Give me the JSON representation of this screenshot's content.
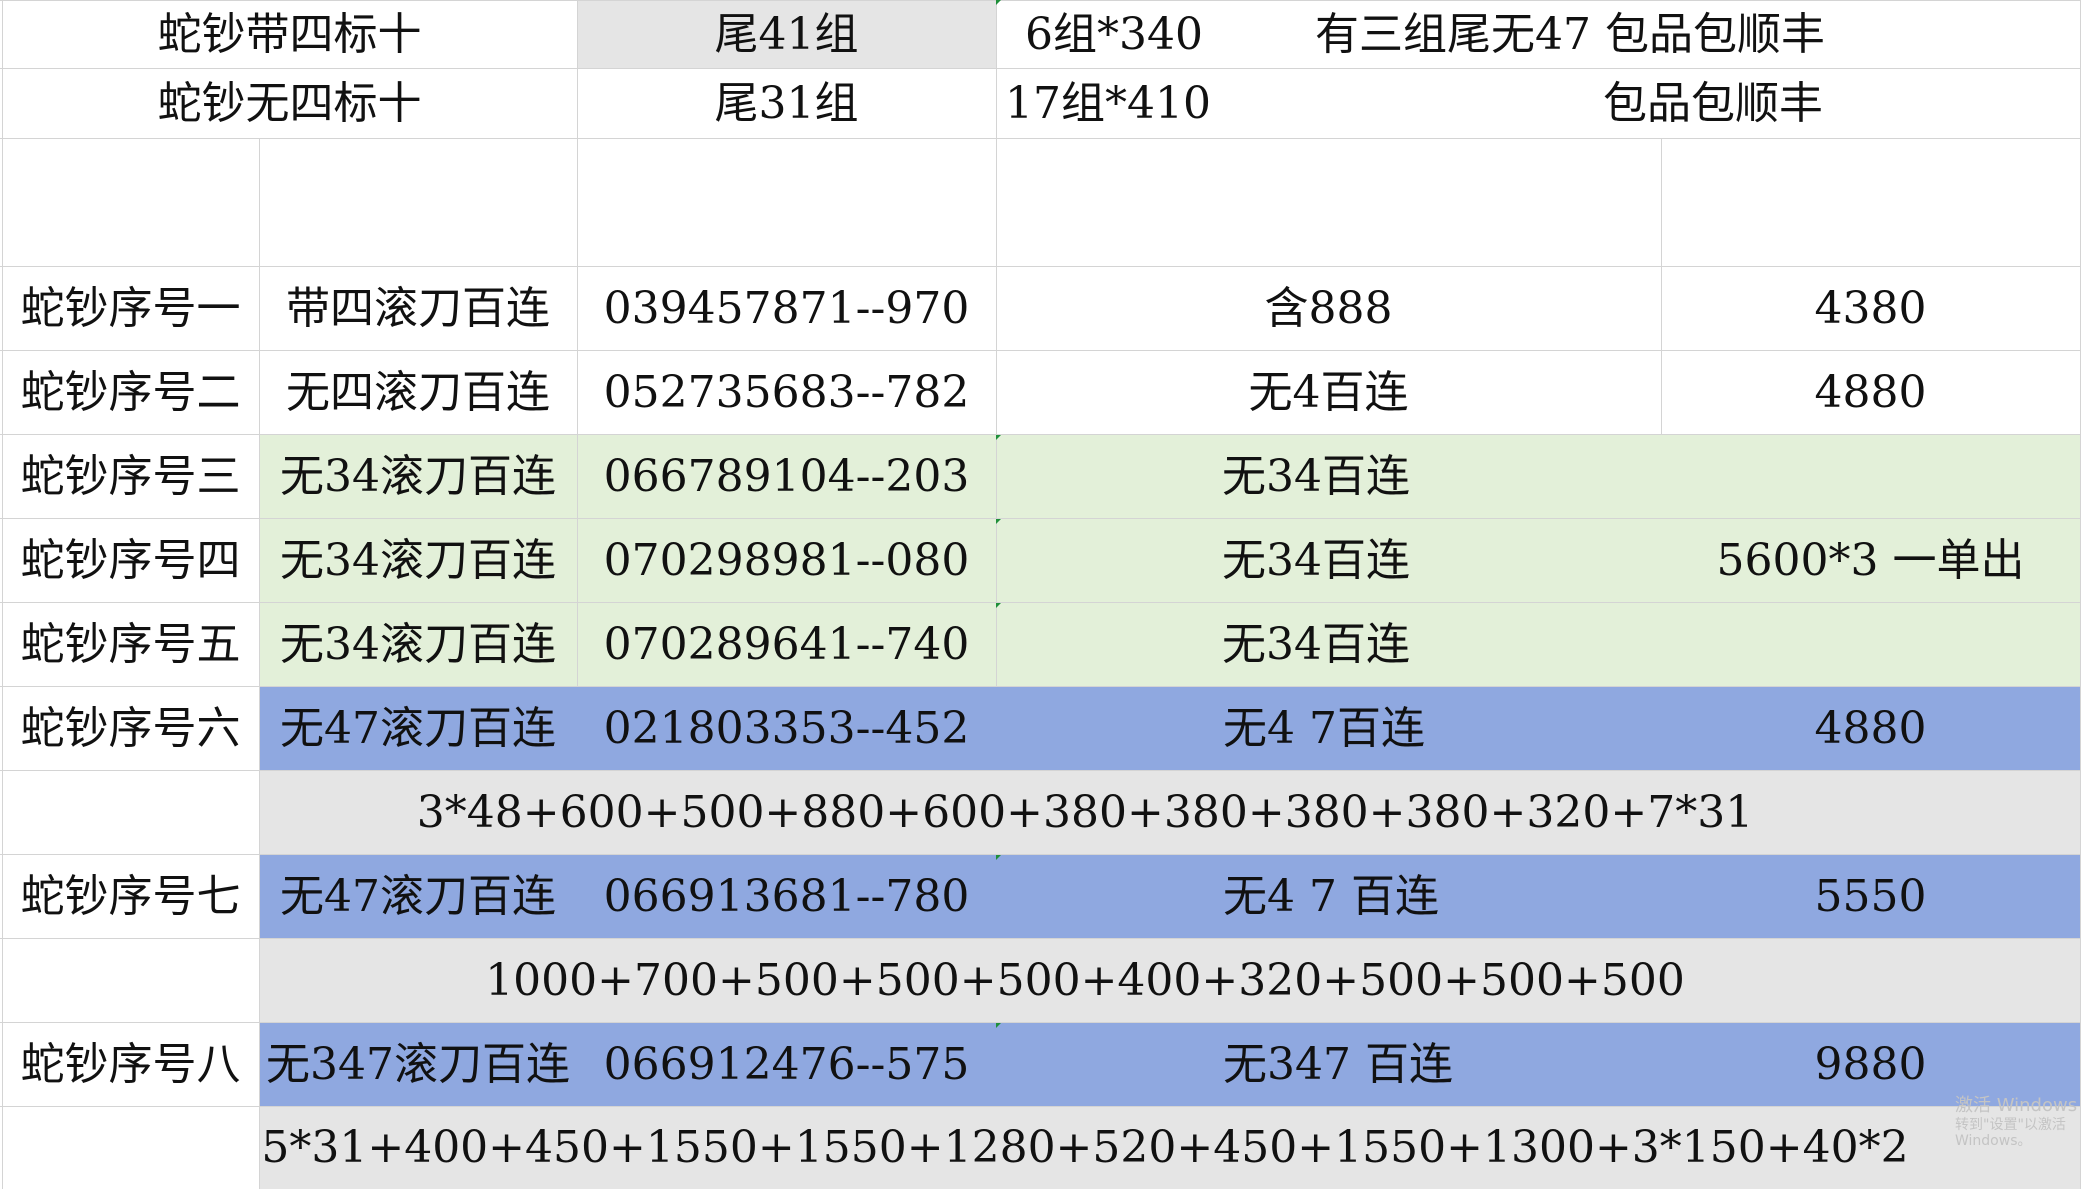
{
  "colors": {
    "green_fill": "#e3f0d9",
    "blue_fill": "#8fa8e0",
    "grey_fill": "#e5e5e5",
    "selected_fill": "#e5e5e5"
  },
  "header_rows": [
    {
      "name": "蛇钞带四标十",
      "tail": "尾41组",
      "groups": "6组*340",
      "note": "有三组尾无47  包品包顺丰"
    },
    {
      "name": "蛇钞无四标十",
      "tail": "尾31组",
      "groups": "17组*410",
      "note": "包品包顺丰"
    }
  ],
  "rows": [
    {
      "label": "蛇钞序号一",
      "desc": "带四滚刀百连",
      "serial": "039457871--970",
      "feature": "含888",
      "price": "4380"
    },
    {
      "label": "蛇钞序号二",
      "desc": "无四滚刀百连",
      "serial": "052735683--782",
      "feature": "无4百连",
      "price": "4880"
    },
    {
      "label": "蛇钞序号三",
      "desc": "无34滚刀百连",
      "serial": "066789104--203",
      "feature": "无34百连"
    },
    {
      "label": "蛇钞序号四",
      "desc": "无34滚刀百连",
      "serial": "070298981--080",
      "feature": "无34百连"
    },
    {
      "label": "蛇钞序号五",
      "desc": "无34滚刀百连",
      "serial": "070289641--740",
      "feature": "无34百连"
    },
    {
      "label": "蛇钞序号六",
      "desc": "无47滚刀百连",
      "serial": "021803353--452",
      "feature": "无4  7百连",
      "price": "4880"
    },
    {
      "label": "蛇钞序号七",
      "desc": "无47滚刀百连",
      "serial": "066913681--780",
      "feature": "无4  7  百连",
      "price": "5550"
    },
    {
      "label": "蛇钞序号八",
      "desc": "无347滚刀百连",
      "serial": "066912476--575",
      "feature": "无347  百连",
      "price": "9880"
    }
  ],
  "merged_price": "5600*3    一单出",
  "formulas": [
    "3*48+600+500+880+600+380+380+380+380+320+7*31",
    "1000+700+500+500+500+400+320+500+500+500",
    "5*31+400+450+1550+1550+1280+520+450+1550+1300+3*150+40*2"
  ],
  "watermark": {
    "line1": "激活 Windows",
    "line2": "转到\"设置\"以激活 Windows。"
  }
}
